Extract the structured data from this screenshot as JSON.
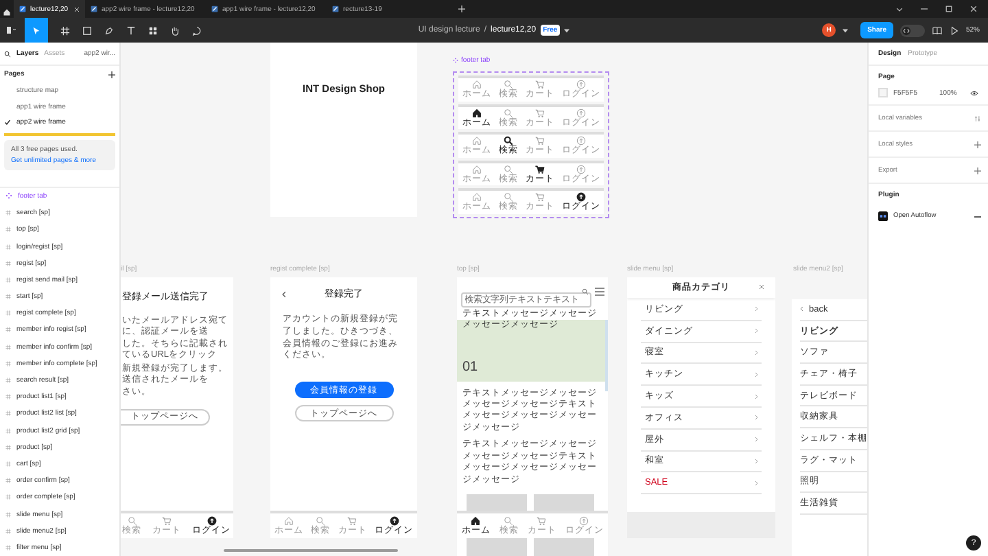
{
  "tabs": [
    {
      "label": "lecture12,20",
      "selected": true
    },
    {
      "label": "app2 wire frame - lecture12,20",
      "selected": false
    },
    {
      "label": "app1 wire frame - lecture12,20",
      "selected": false
    },
    {
      "label": "recture13-19",
      "selected": false
    }
  ],
  "toolbar": {
    "project": "UI design lecture",
    "separator": "/",
    "file": "lecture12,20",
    "plan": "Free",
    "avatar": "H",
    "share": "Share",
    "dev_mode_on": false,
    "zoom": "52%"
  },
  "left_panel": {
    "tabs": [
      {
        "label": "Layers",
        "selected": true
      },
      {
        "label": "Assets",
        "selected": false
      }
    ],
    "page_menu": "app2 wir...",
    "pages_title": "Pages",
    "pages": [
      {
        "label": "structure map",
        "selected": false
      },
      {
        "label": "app1 wire frame",
        "selected": false
      },
      {
        "label": "app2 wire frame",
        "selected": true
      }
    ],
    "notice": "All 3 free pages used.",
    "notice_link": "Get unlimited pages & more",
    "layers": [
      {
        "label": "footer tab",
        "kind": "component"
      },
      {
        "label": "search [sp]",
        "kind": "frame"
      },
      {
        "label": "top [sp]",
        "kind": "frame"
      },
      {
        "label": "login/regist [sp]",
        "kind": "frame"
      },
      {
        "label": "regist [sp]",
        "kind": "frame"
      },
      {
        "label": "regist send mail [sp]",
        "kind": "frame"
      },
      {
        "label": "start [sp]",
        "kind": "frame"
      },
      {
        "label": "regist complete [sp]",
        "kind": "frame"
      },
      {
        "label": "member info regist [sp]",
        "kind": "frame"
      },
      {
        "label": "member info confirm [sp]",
        "kind": "frame"
      },
      {
        "label": "member info complete [sp]",
        "kind": "frame"
      },
      {
        "label": "search result [sp]",
        "kind": "frame"
      },
      {
        "label": "product list1 [sp]",
        "kind": "frame"
      },
      {
        "label": "product list2 list [sp]",
        "kind": "frame"
      },
      {
        "label": "product list2 grid [sp]",
        "kind": "frame"
      },
      {
        "label": "product [sp]",
        "kind": "frame"
      },
      {
        "label": "cart [sp]",
        "kind": "frame"
      },
      {
        "label": "order confirm [sp]",
        "kind": "frame"
      },
      {
        "label": "order complete [sp]",
        "kind": "frame"
      },
      {
        "label": "slide menu [sp]",
        "kind": "frame"
      },
      {
        "label": "slide menu2 [sp]",
        "kind": "frame"
      },
      {
        "label": "filter menu [sp]",
        "kind": "frame"
      }
    ]
  },
  "canvas": {
    "cover": {
      "title": "INT Design Shop"
    },
    "footer_component": {
      "label": "footer tab",
      "variants": [
        {
          "items": [
            {
              "kind": "home",
              "label": "ホーム",
              "selected": false
            },
            {
              "kind": "search",
              "label": "検索",
              "selected": false
            },
            {
              "kind": "cart",
              "label": "カート",
              "selected": false
            },
            {
              "kind": "login",
              "label": "ログイン",
              "selected": false
            }
          ]
        },
        {
          "items": [
            {
              "kind": "home",
              "label": "ホーム",
              "selected": true
            },
            {
              "kind": "search",
              "label": "検索",
              "selected": false
            },
            {
              "kind": "cart",
              "label": "カート",
              "selected": false
            },
            {
              "kind": "login",
              "label": "ログイン",
              "selected": false
            }
          ]
        },
        {
          "items": [
            {
              "kind": "home",
              "label": "ホーム",
              "selected": false
            },
            {
              "kind": "search",
              "label": "検索",
              "selected": true
            },
            {
              "kind": "cart",
              "label": "カート",
              "selected": false
            },
            {
              "kind": "login",
              "label": "ログイン",
              "selected": false
            }
          ]
        },
        {
          "items": [
            {
              "kind": "home",
              "label": "ホーム",
              "selected": false
            },
            {
              "kind": "search",
              "label": "検索",
              "selected": false
            },
            {
              "kind": "cart",
              "label": "カート",
              "selected": true
            },
            {
              "kind": "login",
              "label": "ログイン",
              "selected": false
            }
          ]
        },
        {
          "items": [
            {
              "kind": "home",
              "label": "ホーム",
              "selected": false
            },
            {
              "kind": "search",
              "label": "検索",
              "selected": false
            },
            {
              "kind": "cart",
              "label": "カート",
              "selected": false
            },
            {
              "kind": "login",
              "label": "ログイン",
              "selected": true
            }
          ]
        }
      ]
    },
    "frames": [
      {
        "kind": "send_mail",
        "label": "il [sp]",
        "title": "登録メール送信完了",
        "lines": [
          "いたメールアドレス宛てに、認証メールを送",
          "した。そちらに記載されているURLをクリック",
          "新規登録が完了します。送信されたメールを",
          "さい。"
        ],
        "button": "トップページへ",
        "footer": [
          {
            "kind": "search",
            "label": "検索",
            "selected": false
          },
          {
            "kind": "cart",
            "label": "カート",
            "selected": false
          },
          {
            "kind": "login",
            "label": "ログイン",
            "selected": true
          }
        ]
      },
      {
        "kind": "complete",
        "label": "regist complete [sp]",
        "title": "登録完了",
        "body": "アカウントの新規登録が完了しました。ひきつづき、会員情報のご登録にお進みください。",
        "primary": "会員情報の登録",
        "secondary": "トップページへ",
        "footer": [
          {
            "kind": "home",
            "label": "ホーム",
            "selected": false
          },
          {
            "kind": "search",
            "label": "検索",
            "selected": false
          },
          {
            "kind": "cart",
            "label": "カート",
            "selected": false
          },
          {
            "kind": "login",
            "label": "ログイン",
            "selected": true
          }
        ]
      },
      {
        "kind": "top",
        "label": "top [sp]",
        "search": {
          "placeholder": "検索文字列テキストテキスト"
        },
        "heading": "テキストメッセージメッセージメッセージメッセージ",
        "slide_number": "01",
        "paragraphs": [
          "テキストメッセージメッセージメッセージメッセージテキストメッセージメッセージメッセージメッセージ",
          "テキストメッセージメッセージメッセージメッセージテキストメッセージメッセージメッセージメッセージ"
        ],
        "footer": [
          {
            "kind": "home",
            "label": "ホーム",
            "selected": true
          },
          {
            "kind": "search",
            "label": "検索",
            "selected": false
          },
          {
            "kind": "cart",
            "label": "カート",
            "selected": false
          },
          {
            "kind": "login",
            "label": "ログイン",
            "selected": false
          }
        ]
      },
      {
        "kind": "menu",
        "label": "slide menu [sp]",
        "title": "商品カテゴリ",
        "items": [
          {
            "label": "リビング",
            "kind": "category"
          },
          {
            "label": "ダイニング",
            "kind": "category"
          },
          {
            "label": "寝室",
            "kind": "category"
          },
          {
            "label": "キッチン",
            "kind": "category"
          },
          {
            "label": "キッズ",
            "kind": "category"
          },
          {
            "label": "オフィス",
            "kind": "category"
          },
          {
            "label": "屋外",
            "kind": "category"
          },
          {
            "label": "和室",
            "kind": "category"
          },
          {
            "label": "SALE",
            "kind": "sale"
          }
        ]
      },
      {
        "kind": "submenu",
        "label": "slide menu2 [sp]",
        "back": "back",
        "items": [
          {
            "label": "リビング",
            "kind": "heading"
          },
          {
            "label": "ソファ",
            "kind": "item"
          },
          {
            "label": "チェア・椅子",
            "kind": "item"
          },
          {
            "label": "テレビボード",
            "kind": "item"
          },
          {
            "label": "収納家具",
            "kind": "item"
          },
          {
            "label": "シェルフ・本棚",
            "kind": "item"
          },
          {
            "label": "ラグ・マット",
            "kind": "item"
          },
          {
            "label": "照明",
            "kind": "item"
          },
          {
            "label": "生活雑貨",
            "kind": "item"
          }
        ]
      }
    ]
  },
  "right_panel": {
    "tabs": [
      {
        "label": "Design",
        "selected": true
      },
      {
        "label": "Prototype",
        "selected": false
      }
    ],
    "page_title": "Page",
    "page_color": "F5F5F5",
    "page_opacity": "100%",
    "sections": [
      {
        "label": "Local variables",
        "kind": "variables"
      },
      {
        "label": "Local styles",
        "kind": "add"
      },
      {
        "label": "Export",
        "kind": "add"
      }
    ],
    "plugin_title": "Plugin",
    "plugin": "Open Autoflow",
    "help": "?"
  }
}
